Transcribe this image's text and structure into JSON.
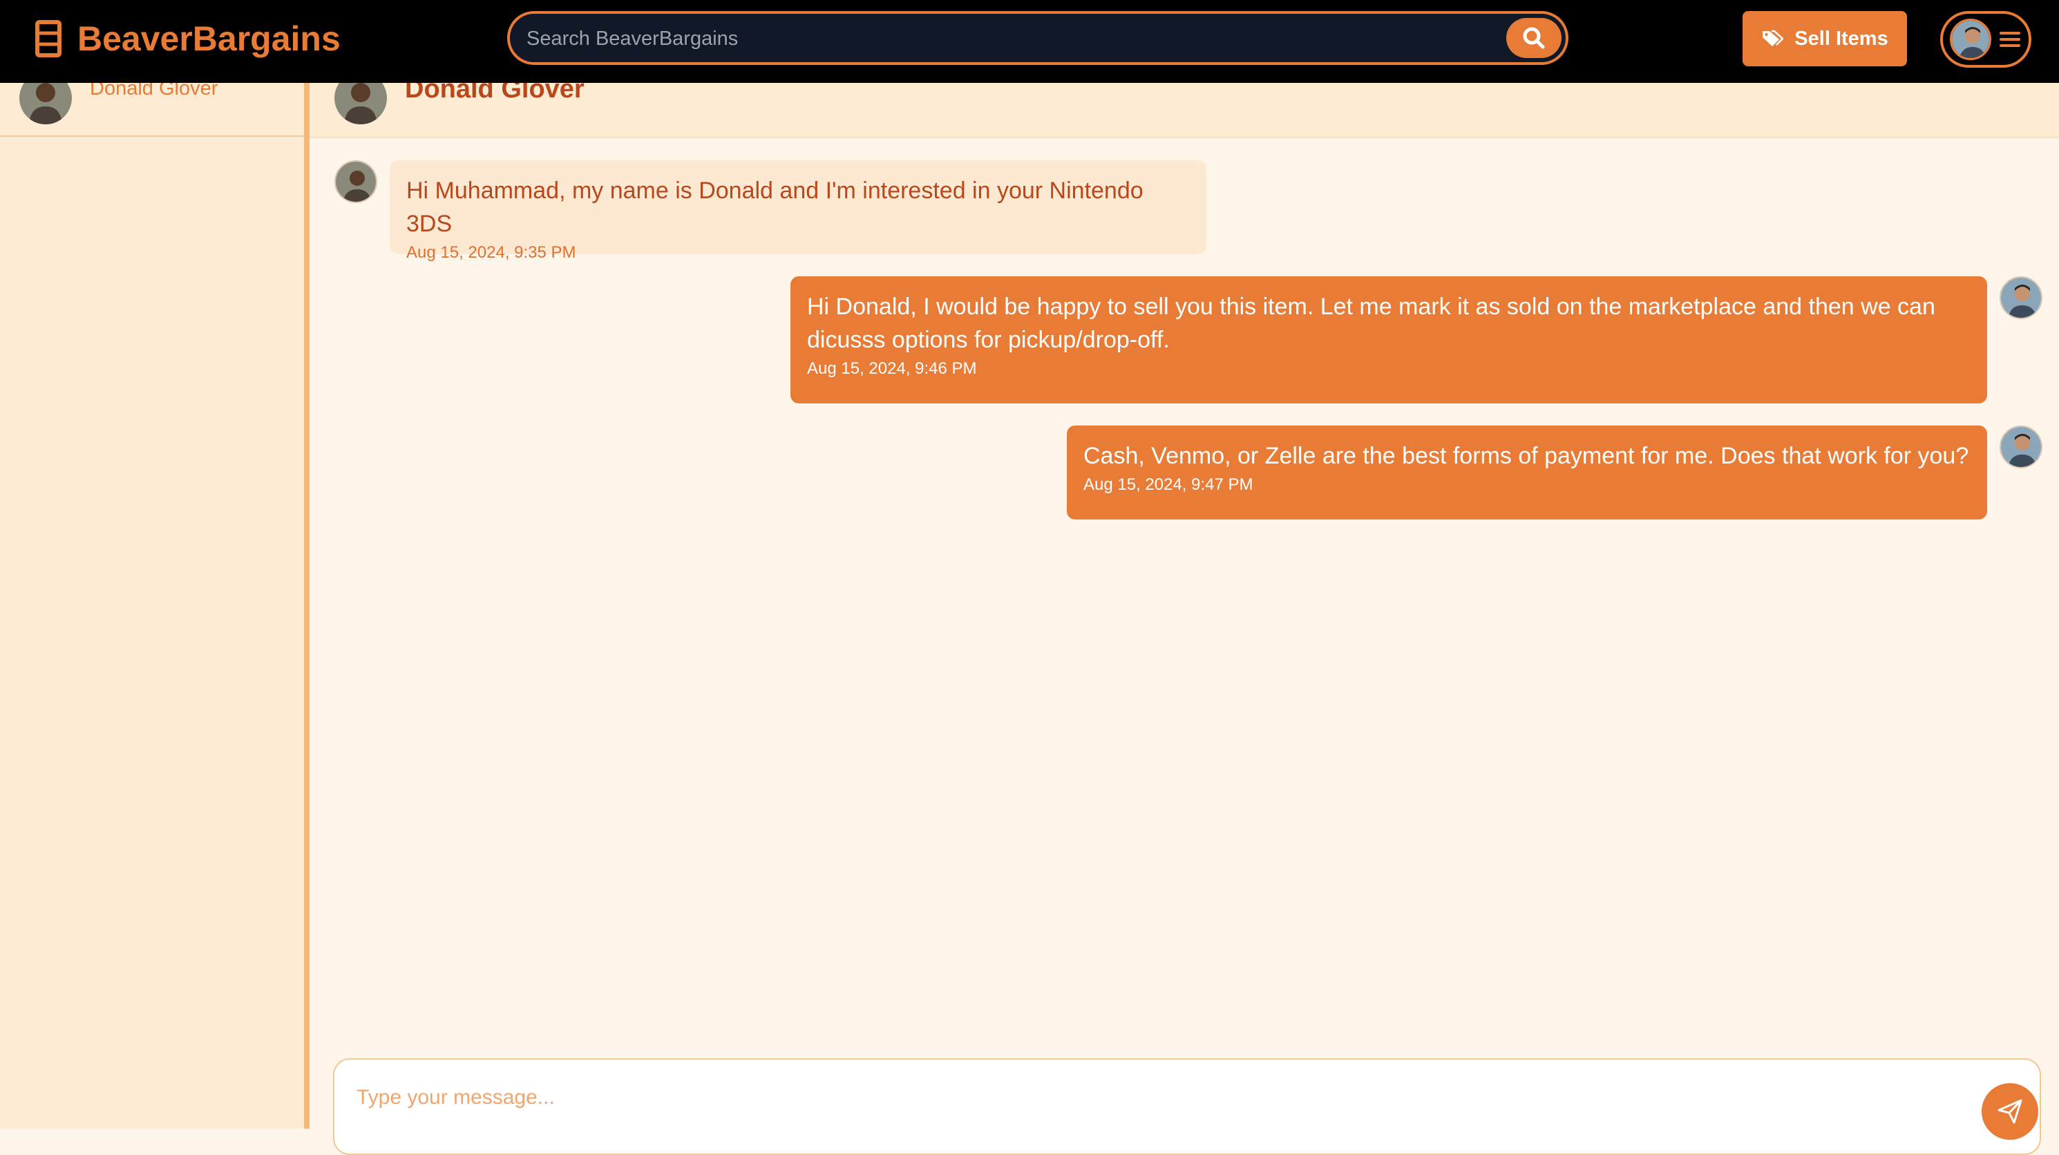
{
  "app": {
    "name": "BeaverBargains"
  },
  "search": {
    "placeholder": "Search BeaverBargains"
  },
  "header": {
    "sell_label": "Sell Items"
  },
  "conversations": [
    {
      "name": "Donald Glover"
    }
  ],
  "chat": {
    "partner_name": "Donald Glover",
    "messages": [
      {
        "direction": "incoming",
        "text": "Hi Muhammad, my name is Donald and I'm interested in your Nintendo 3DS",
        "time": "Aug 15, 2024, 9:35 PM"
      },
      {
        "direction": "outgoing",
        "text": "Hi Donald, I would be happy to sell you this item. Let me mark it as sold on the marketplace and then we can dicusss options for pickup/drop-off.",
        "time": "Aug 15, 2024, 9:46 PM"
      },
      {
        "direction": "outgoing",
        "text": "Cash, Venmo, or Zelle are the best forms of payment for me. Does that work for you?",
        "time": "Aug 15, 2024, 9:47 PM"
      }
    ]
  },
  "composer": {
    "placeholder": "Type your message..."
  },
  "colors": {
    "accent": "#e87b36",
    "topbar": "#000000",
    "sidebar": "#fdebd3",
    "chat_bg": "#fef6ea",
    "incoming_bubble": "#fde9d2",
    "incoming_text": "#b8481c"
  },
  "icons": {
    "logo": "beaver-cup-icon",
    "search": "search-icon",
    "sell": "tags-icon",
    "menu": "hamburger-menu-icon",
    "send": "send-icon"
  }
}
